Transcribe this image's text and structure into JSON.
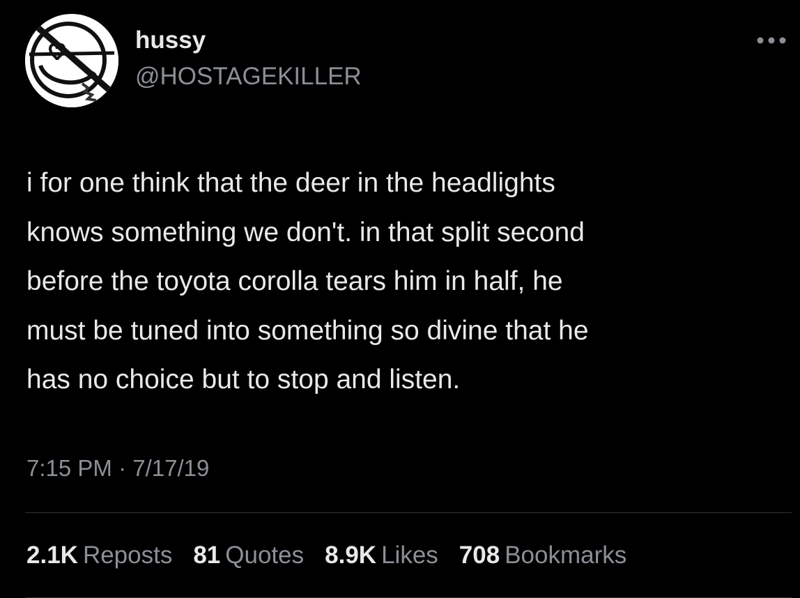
{
  "author": {
    "display_name": "hussy",
    "handle": "@HOSTAGEKILLER",
    "avatar_icon": "smiley-face-crossed-out-icon"
  },
  "more_icon": "more-horizontal-icon",
  "tweet": {
    "text": "i for one think that the deer in the headlights\nknows something we don't. in that split second\nbefore the toyota corolla tears him in half, he\nmust be tuned into something so divine that he\nhas no choice but to stop and listen.",
    "time": "7:15 PM",
    "separator": "·",
    "date": "7/17/19"
  },
  "stats": [
    {
      "count": "2.1K",
      "label": "Reposts"
    },
    {
      "count": "81",
      "label": "Quotes"
    },
    {
      "count": "8.9K",
      "label": "Likes"
    },
    {
      "count": "708",
      "label": "Bookmarks"
    }
  ],
  "colors": {
    "background": "#000000",
    "primary_text": "#e7e9ea",
    "secondary_text": "#8b9096",
    "divider": "#2f3336"
  }
}
